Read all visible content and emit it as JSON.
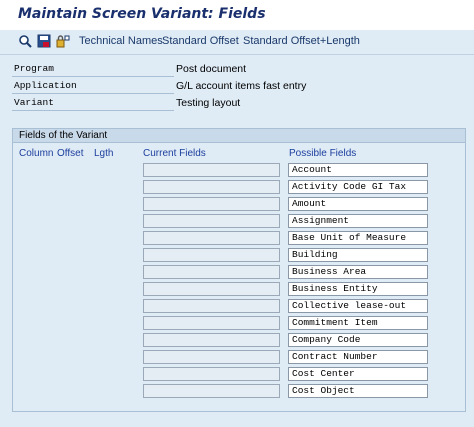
{
  "window": {
    "title": "Maintain Screen Variant: Fields"
  },
  "toolbar": {
    "icons": [
      "display-icon",
      "save-icon",
      "permission-icon"
    ],
    "links": [
      "Technical Names",
      "Standard Offset",
      "Standard Offset+Length"
    ]
  },
  "header": {
    "program": {
      "label": "Program",
      "value": "Post document"
    },
    "application": {
      "label": "Application",
      "value": "G/L account items fast entry"
    },
    "variant": {
      "label": "Variant",
      "value": "Testing layout"
    }
  },
  "fields_group": {
    "title": "Fields of the Variant",
    "columns": {
      "column": "Column",
      "offset": "Offset",
      "length": "Lgth",
      "current": "Current Fields",
      "possible": "Possible Fields"
    },
    "current_fields": [
      "",
      "",
      "",
      "",
      "",
      "",
      "",
      "",
      "",
      "",
      "",
      "",
      "",
      ""
    ],
    "possible_fields": [
      "Account",
      "Activity Code GI Tax",
      "Amount",
      "Assignment",
      "Base Unit of Measure",
      "Building",
      "Business Area",
      "Business Entity",
      "Collective lease-out",
      "Commitment Item",
      "Company Code",
      "Contract Number",
      "Cost Center",
      "Cost Object"
    ]
  },
  "colors": {
    "background": "#dfebf5",
    "title": "#1a2f6d",
    "column_header": "#1d3f9e"
  }
}
